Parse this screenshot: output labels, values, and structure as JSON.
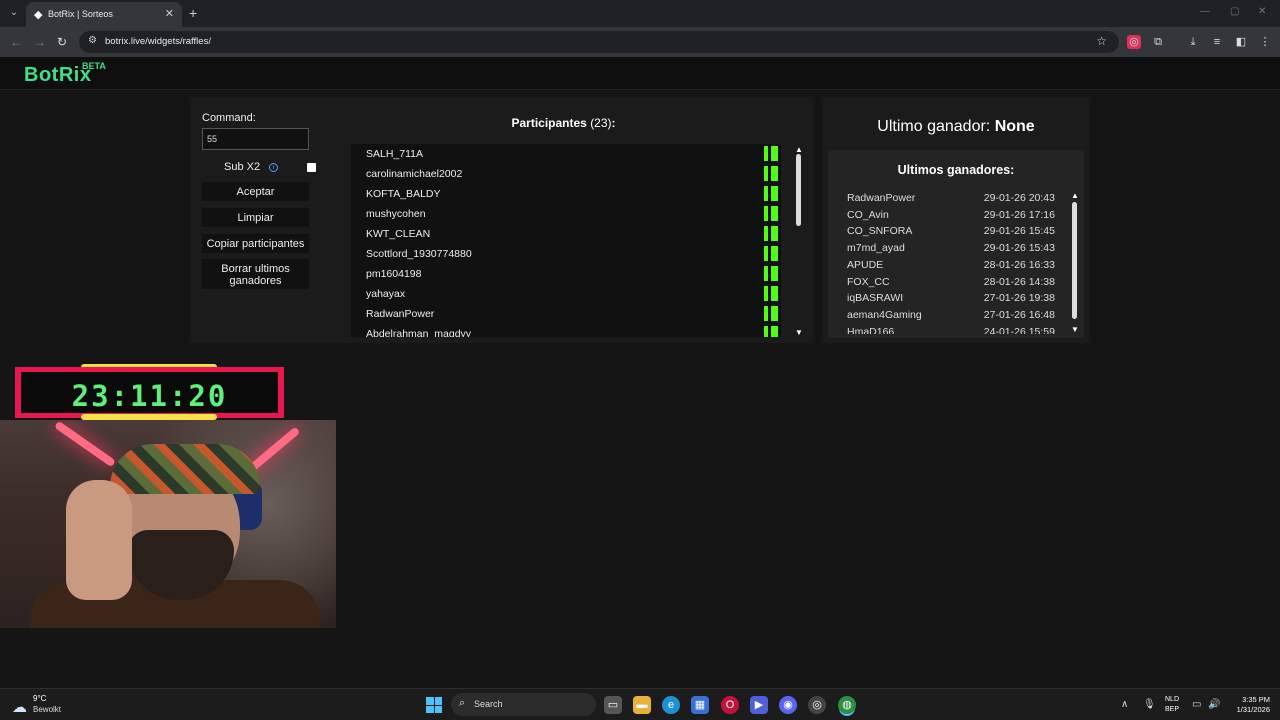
{
  "browser": {
    "tab_title": "BotRix | Sorteos",
    "url": "botrix.live/widgets/raffles/"
  },
  "site": {
    "logo": "BotRix",
    "beta_label": "BETA"
  },
  "raffle": {
    "command_label": "Command:",
    "command_value": "55",
    "sub_x2_label": "Sub X2",
    "sub_x2_checked": false,
    "buttons": {
      "accept": "Aceptar",
      "clear": "Limpiar",
      "copy": "Copiar participantes",
      "delete_winners": "Borrar ultimos ganadores"
    },
    "participants_label": "Participantes",
    "participants_count": "(23)",
    "participants_colon": ":",
    "participants": [
      "SALH_711A",
      "carolinamichael2002",
      "KOFTA_BALDY",
      "mushycohen",
      "KWT_CLEAN",
      "Scottlord_1930774880",
      "pm1604198",
      "yahayax",
      "RadwanPower",
      "Abdelrahman_magdyy"
    ],
    "platform_icon": "kick-icon",
    "platform_color": "#53fc18"
  },
  "winners": {
    "last_winner_label": "Ultimo ganador:",
    "last_winner_value": "None",
    "recent_title": "Ultimos ganadores:",
    "recent": [
      {
        "name": "RadwanPower",
        "date": "29-01-26 20:43"
      },
      {
        "name": "CO_Avin",
        "date": "29-01-26 17:16"
      },
      {
        "name": "CO_SNFORA",
        "date": "29-01-26 15:45"
      },
      {
        "name": "m7md_ayad",
        "date": "29-01-26 15:43"
      },
      {
        "name": "APUDE",
        "date": "28-01-26 16:33"
      },
      {
        "name": "FOX_CC",
        "date": "28-01-26 14:38"
      },
      {
        "name": "iqBASRAWI",
        "date": "27-01-26 19:38"
      },
      {
        "name": "aeman4Gaming",
        "date": "27-01-26 16:48"
      },
      {
        "name": "HmaD166",
        "date": "24-01-26 15:59"
      }
    ]
  },
  "overlay": {
    "timer": "23:11:20",
    "timer_color": "#5ff07a",
    "frame_color": "#e8174d"
  },
  "taskbar": {
    "temperature": "9°C",
    "weather": "Bewolkt",
    "search_label": "Search",
    "lang_1": "NLD",
    "lang_2": "BEP",
    "time": "3:35 PM",
    "date": "1/31/2026"
  }
}
